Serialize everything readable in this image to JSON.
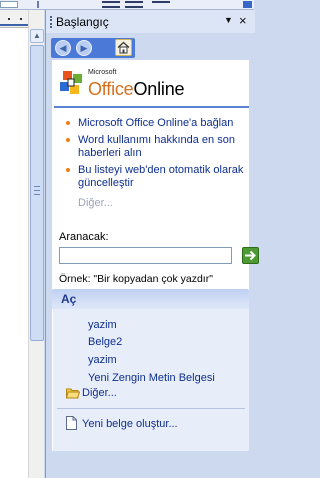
{
  "colors": {
    "pane_bg": "#cdd9ee",
    "link": "#0e2f8f",
    "accent_blue": "#4b79d7",
    "bullet_orange": "#ee7d12",
    "go_green": "#4c9a31"
  },
  "pane": {
    "title": "Başlangıç",
    "menu_icon": "triangle-down-icon",
    "close_icon": "close-icon",
    "nav": {
      "back_icon": "back-arrow-icon",
      "forward_icon": "forward-arrow-icon",
      "home_icon": "home-icon"
    }
  },
  "office_online": {
    "logo_superscript": "Microsoft",
    "logo_word1": "Office",
    "logo_word2": "Online",
    "links": [
      "Microsoft Office Online'a bağlan",
      "Word kullanımı hakkında en son haberleri alın",
      "Bu listeyi web'den otomatik olarak güncelleştir"
    ],
    "more_label": "Diğer..."
  },
  "search": {
    "label": "Aranacak:",
    "value": "",
    "example": "Örnek:  \"Bir kopyadan çok yazdır\""
  },
  "open_section": {
    "title": "Aç",
    "files": [
      "yazim",
      "Belge2",
      "yazim",
      "Yeni Zengin Metin Belgesi"
    ],
    "more_label": "Diğer...",
    "new_document_label": "Yeni belge oluştur..."
  }
}
